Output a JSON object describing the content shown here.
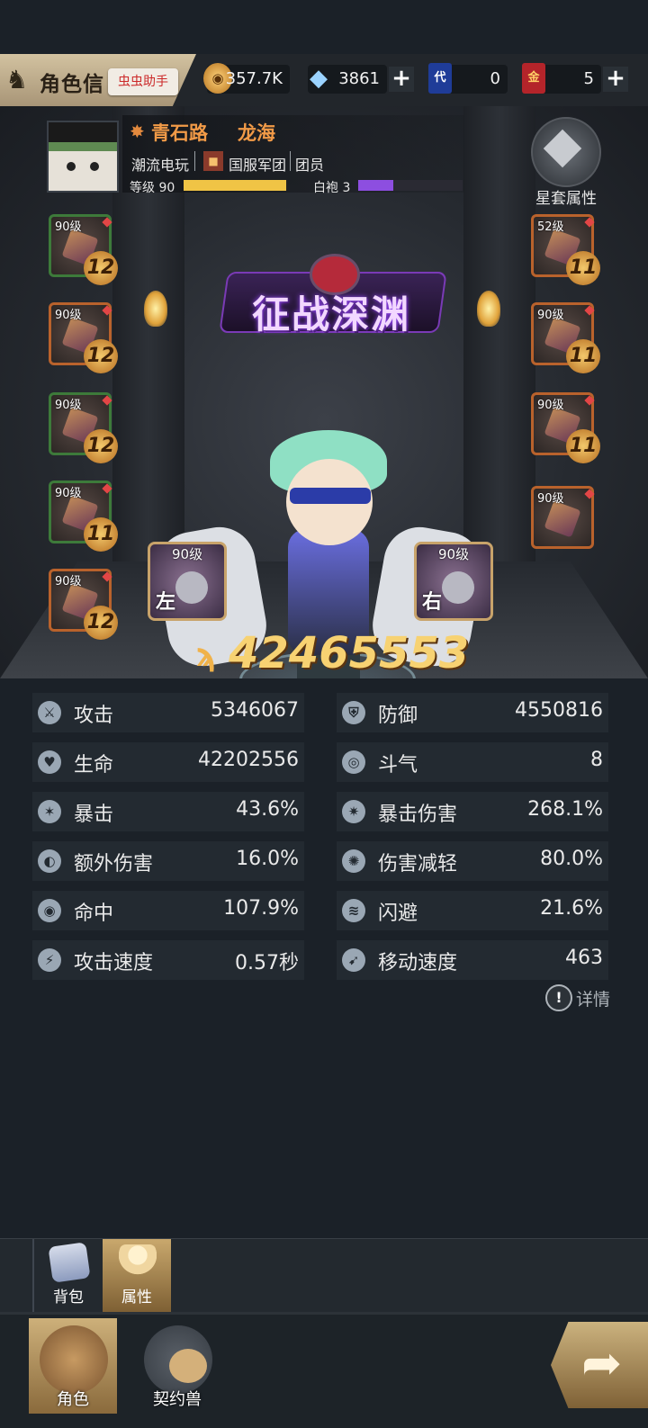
{
  "topbar": {
    "title": "角色信",
    "helper_badge": "虫虫助手",
    "resources": [
      {
        "icon": "coin-icon",
        "value": "357.7K",
        "has_plus": false
      },
      {
        "icon": "crystal-icon",
        "value": "3861",
        "has_plus": true
      },
      {
        "icon": "card-dai-icon",
        "glyph": "代",
        "value": "0",
        "has_plus": false
      },
      {
        "icon": "card-jin-icon",
        "glyph": "金",
        "value": "5",
        "has_plus": true
      }
    ]
  },
  "player": {
    "server": "青石路",
    "name": "龙海",
    "title": "潮流电玩",
    "guild": "国服军团",
    "role": "团员",
    "level_label": "等级 90",
    "robe_label": "白袍 3",
    "level_progress": 0.98,
    "robe_progress": 0.34
  },
  "star_set": {
    "label": "星套属性"
  },
  "event": {
    "title": "征战深渊"
  },
  "equipment_left": [
    {
      "level": "90级",
      "star": "12",
      "frame": "green"
    },
    {
      "level": "90级",
      "star": "12",
      "frame": "orange"
    },
    {
      "level": "90级",
      "star": "12",
      "frame": "green"
    },
    {
      "level": "90级",
      "star": "11",
      "frame": "green"
    },
    {
      "level": "90级",
      "star": "12",
      "frame": "orange"
    }
  ],
  "equipment_right": [
    {
      "level": "52级",
      "star": "11",
      "frame": "orange"
    },
    {
      "level": "90级",
      "star": "11",
      "frame": "orange"
    },
    {
      "level": "90级",
      "star": "11",
      "frame": "orange"
    },
    {
      "level": "90级",
      "star": "",
      "frame": "orange"
    }
  ],
  "weapons": [
    {
      "level": "90级",
      "side": "左"
    },
    {
      "level": "90级",
      "side": "右"
    }
  ],
  "power": {
    "value": "42465553"
  },
  "stats": [
    {
      "name": "攻击",
      "value": "5346067",
      "icon": "sword-icon"
    },
    {
      "name": "防御",
      "value": "4550816",
      "icon": "shield-icon"
    },
    {
      "name": "生命",
      "value": "42202556",
      "icon": "heart-icon"
    },
    {
      "name": "斗气",
      "value": "8",
      "icon": "swirl-icon"
    },
    {
      "name": "暴击",
      "value": "43.6%",
      "icon": "crit-icon"
    },
    {
      "name": "暴击伤害",
      "value": "268.1%",
      "icon": "burst-icon"
    },
    {
      "name": "额外伤害",
      "value": "16.0%",
      "icon": "extra-damage-icon"
    },
    {
      "name": "伤害减轻",
      "value": "80.0%",
      "icon": "damage-reduction-icon"
    },
    {
      "name": "命中",
      "value": "107.9%",
      "icon": "target-icon"
    },
    {
      "name": "闪避",
      "value": "21.6%",
      "icon": "dodge-icon"
    },
    {
      "name": "攻击速度",
      "value": "0.57秒",
      "icon": "attack-speed-icon"
    },
    {
      "name": "移动速度",
      "value": "463",
      "icon": "move-speed-icon"
    }
  ],
  "detail": {
    "label": "详情"
  },
  "subtabs": [
    {
      "label": "背包",
      "icon": "backpack-icon"
    },
    {
      "label": "属性",
      "icon": "person-icon"
    }
  ],
  "nav": [
    {
      "label": "角色",
      "icon": "character-icon"
    },
    {
      "label": "契约兽",
      "icon": "paw-icon"
    }
  ]
}
